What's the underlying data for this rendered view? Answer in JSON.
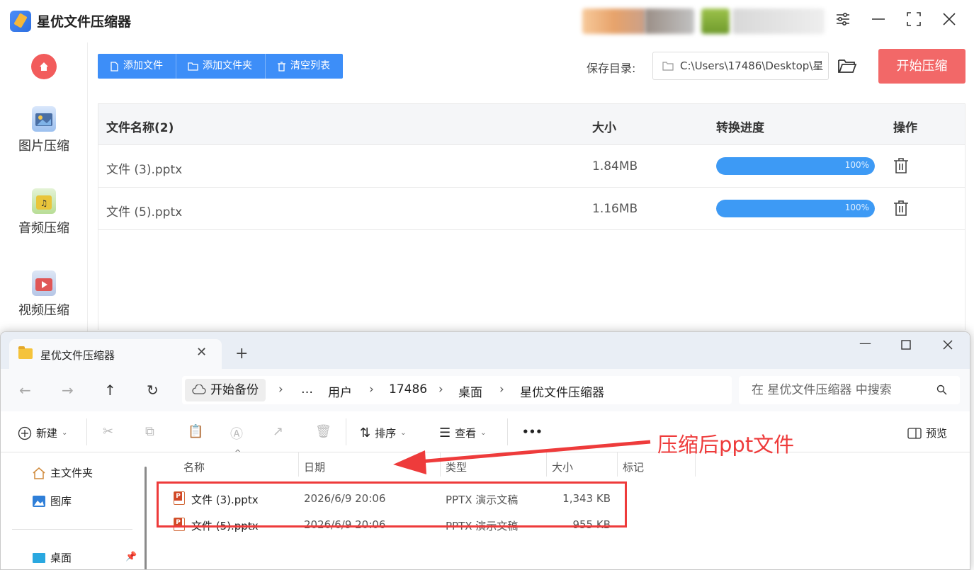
{
  "app": {
    "title": "星优文件压缩器",
    "sidebar": [
      {
        "label": "图片压缩"
      },
      {
        "label": "音频压缩"
      },
      {
        "label": "视频压缩"
      }
    ],
    "toolbar": {
      "add_file": "添加文件",
      "add_folder": "添加文件夹",
      "clear_list": "清空列表"
    },
    "save_dir_label": "保存目录:",
    "save_dir_value": "C:\\Users\\17486\\Desktop\\星",
    "start_button": "开始压缩",
    "table": {
      "headers": [
        "文件名称(2)",
        "大小",
        "转换进度",
        "操作"
      ],
      "rows": [
        {
          "name": "文件 (3).pptx",
          "size": "1.84MB",
          "progress": 100,
          "progress_label": "100%"
        },
        {
          "name": "文件 (5).pptx",
          "size": "1.16MB",
          "progress": 100,
          "progress_label": "100%"
        }
      ]
    }
  },
  "explorer": {
    "tab_title": "星优文件压缩器",
    "backup": "开始备份",
    "breadcrumb": [
      "…",
      "用户",
      "17486",
      "桌面",
      "星优文件压缩器"
    ],
    "search_placeholder": "在 星优文件压缩器 中搜索",
    "commands": {
      "new": "新建",
      "sort": "排序",
      "view": "查看",
      "more": "•••",
      "preview": "预览"
    },
    "nav": [
      "主文件夹",
      "图库",
      "桌面"
    ],
    "columns": [
      "名称",
      "日期",
      "类型",
      "大小",
      "标记"
    ],
    "files": [
      {
        "name": "文件 (3).pptx",
        "date": "2026/6/9 20:06",
        "type": "PPTX 演示文稿",
        "size": "1,343 KB"
      },
      {
        "name": "文件 (5).pptx",
        "date": "2026/6/9 20:06",
        "type": "PPTX 演示文稿",
        "size": "955 KB"
      }
    ]
  },
  "annotation": {
    "text": "压缩后ppt文件",
    "color": "#ee3b3b"
  },
  "colors": {
    "primary": "#3d8ef8",
    "start": "#f26868",
    "progress": "#3d9af5"
  }
}
